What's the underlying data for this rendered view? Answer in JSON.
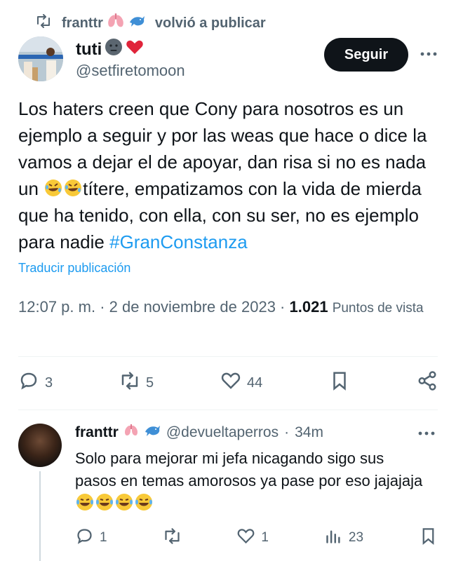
{
  "repost": {
    "reposter": "franttr",
    "label": "volvió a publicar",
    "icon": "repost-icon"
  },
  "author": {
    "name": "tuti",
    "handle": "@setfiretomoon",
    "follow_label": "Seguir"
  },
  "tweet": {
    "text_before_emoji": "Los haters creen que Cony para nosotros es un ejemplo a seguir y por las weas que hace o dice la vamos a dejar el de apoyar, dan risa si no es nada un ",
    "text_after_emoji": "títere, empatizamos con la vida de mierda que ha tenido, con ella, con su ser, no es ejemplo para nadie ",
    "hashtag": "#GranConstanza",
    "translate_label": "Traducir publicación",
    "time": "12:07 p. m.",
    "date": "2 de noviembre de 2023",
    "views_count": "1.021",
    "views_label": "Puntos de vista"
  },
  "actions": {
    "replies": "3",
    "reposts": "5",
    "likes": "44"
  },
  "reply": {
    "name": "franttr",
    "handle": "@devueltaperros",
    "age": "34m",
    "text": "Solo para mejorar mi jefa nicagando sigo sus pasos en temas amorosos ya pase por eso jajajaja",
    "replies": "1",
    "likes": "1",
    "views": "23"
  },
  "colors": {
    "link": "#1d9bf0",
    "secondary_text": "#536471",
    "primary_text": "#0f1419",
    "button_bg": "#0f1419"
  }
}
